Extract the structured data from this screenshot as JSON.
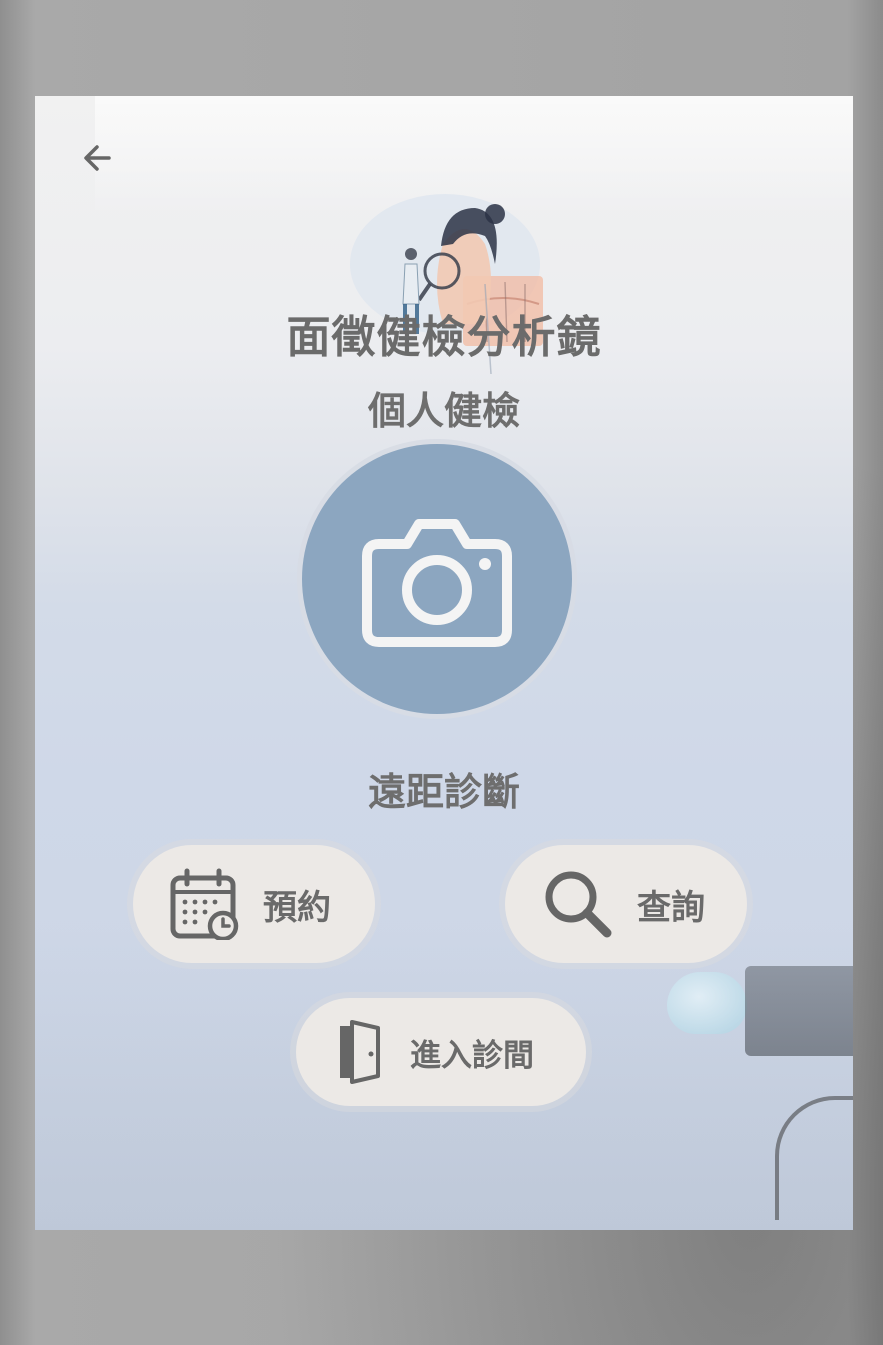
{
  "app": {
    "title": "面徵健檢分析鏡"
  },
  "nav": {
    "back_icon": "arrow-left-icon"
  },
  "sections": {
    "personal": {
      "title": "個人健檢",
      "camera_icon": "camera-icon"
    },
    "remote": {
      "title": "遠距診斷",
      "buttons": {
        "appointment": {
          "label": "預約",
          "icon": "calendar-clock-icon"
        },
        "query": {
          "label": "查詢",
          "icon": "search-icon"
        },
        "enter": {
          "label": "進入診間",
          "icon": "door-icon"
        }
      }
    }
  },
  "colors": {
    "camera_button": "#8ca6c0",
    "pill_button": "#ece9e6",
    "text": "#6b6b6b",
    "icon": "#666666"
  }
}
